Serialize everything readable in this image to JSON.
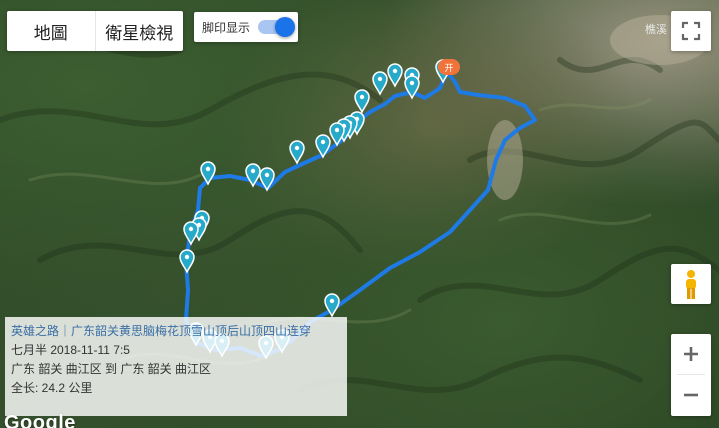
{
  "map_type": {
    "options": [
      "地圖",
      "衛星檢視"
    ],
    "selected": "衛星檢視"
  },
  "toggle": {
    "label": "脚印显示",
    "state": "on"
  },
  "controls": {
    "fullscreen_icon": "fullscreen-icon",
    "pegman_icon": "pegman-icon",
    "zoom_in": "+",
    "zoom_out": "−"
  },
  "map": {
    "place_label": "樵溪",
    "start_marker_text": "开",
    "route_color": "#1e7be6",
    "marker_color": "#27a9c9"
  },
  "info": {
    "title": "英雄之路｜广东韶关黄思脑梅花顶雪山顶后山顶四山连穿",
    "author_date": "七月半 2018-11-11 7:5",
    "from_to": "广东 韶关 曲江区 到 广东 韶关 曲江区",
    "distance": "全长: 24.2 公里"
  },
  "attribution": "Google"
}
